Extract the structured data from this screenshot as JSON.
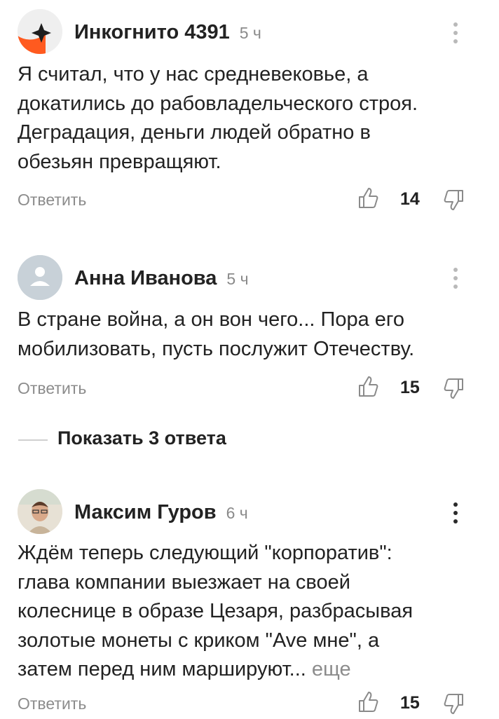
{
  "comments": [
    {
      "author": "Инкогнито 4391",
      "time": "5 ч",
      "lines": [
        "Я считал, что у нас средневековье, а",
        "докатились до рабовладельческого строя.",
        "Деградация, деньги людей обратно в",
        "обезьян превращяют."
      ],
      "reply_label": "Ответить",
      "likes": "14",
      "avatar_icon": "incognito-avatar-icon"
    },
    {
      "author": "Анна Иванова",
      "time": "5 ч",
      "lines": [
        "В стране война, а он вон чего... Пора его",
        "мобилизовать, пусть послужит Отечеству."
      ],
      "reply_label": "Ответить",
      "likes": "15",
      "avatar_icon": "user-placeholder-icon"
    },
    {
      "author": "Максим Гуров",
      "time": "6 ч",
      "lines": [
        "Ждём теперь следующий \"корпоратив\":",
        "глава компании выезжает на своей",
        "колеснице в образе Цезаря, разбрасывая",
        "золотые монеты с криком \"Ave мне\", а",
        "затем перед ним маршируют..."
      ],
      "more_label": "еще",
      "reply_label": "Ответить",
      "likes": "15",
      "avatar_icon": "user-photo-avatar"
    }
  ],
  "show_replies_label": "Показать 3 ответа",
  "colors": {
    "text": "#222222",
    "muted": "#8c8c8c",
    "avatar_orange": "#ff5a1f",
    "avatar_gray": "#c8d1d8"
  }
}
